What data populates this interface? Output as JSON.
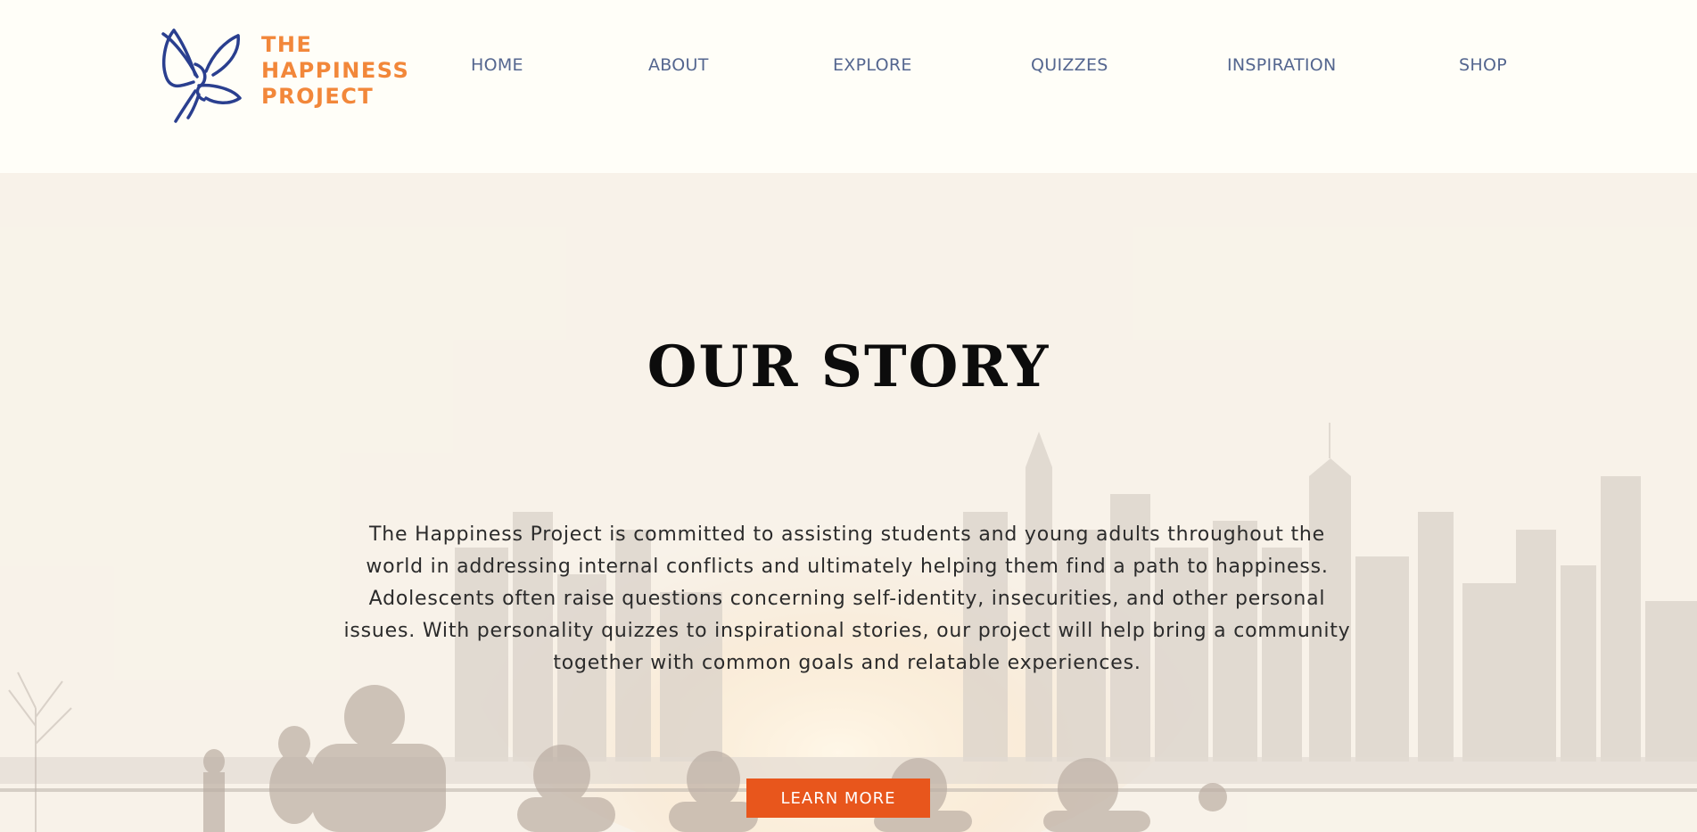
{
  "logo": {
    "line1": "THE",
    "line2": "HAPPINESS",
    "line3": "PROJECT",
    "icon": "butterfly-icon",
    "icon_color": "#2a3f8f",
    "text_color": "#f2873a"
  },
  "nav": {
    "items": [
      {
        "label": "HOME"
      },
      {
        "label": "ABOUT"
      },
      {
        "label": "EXPLORE"
      },
      {
        "label": "QUIZZES"
      },
      {
        "label": "INSPIRATION"
      },
      {
        "label": "SHOP"
      }
    ],
    "color": "#54668f"
  },
  "hero": {
    "title": "OUR STORY",
    "body": "The Happiness Project is committed to assisting students and young adults throughout the world in addressing internal conflicts and ultimately helping them find a path to happiness. Adolescents often raise questions concerning self-identity, insecurities, and other personal issues. With personality quizzes to inspirational stories, our project will help bring a community together with common goals and relatable experiences.",
    "cta_label": "LEARN MORE",
    "cta_color": "#e8561c",
    "background": "city-skyline-waterfront-photo"
  }
}
